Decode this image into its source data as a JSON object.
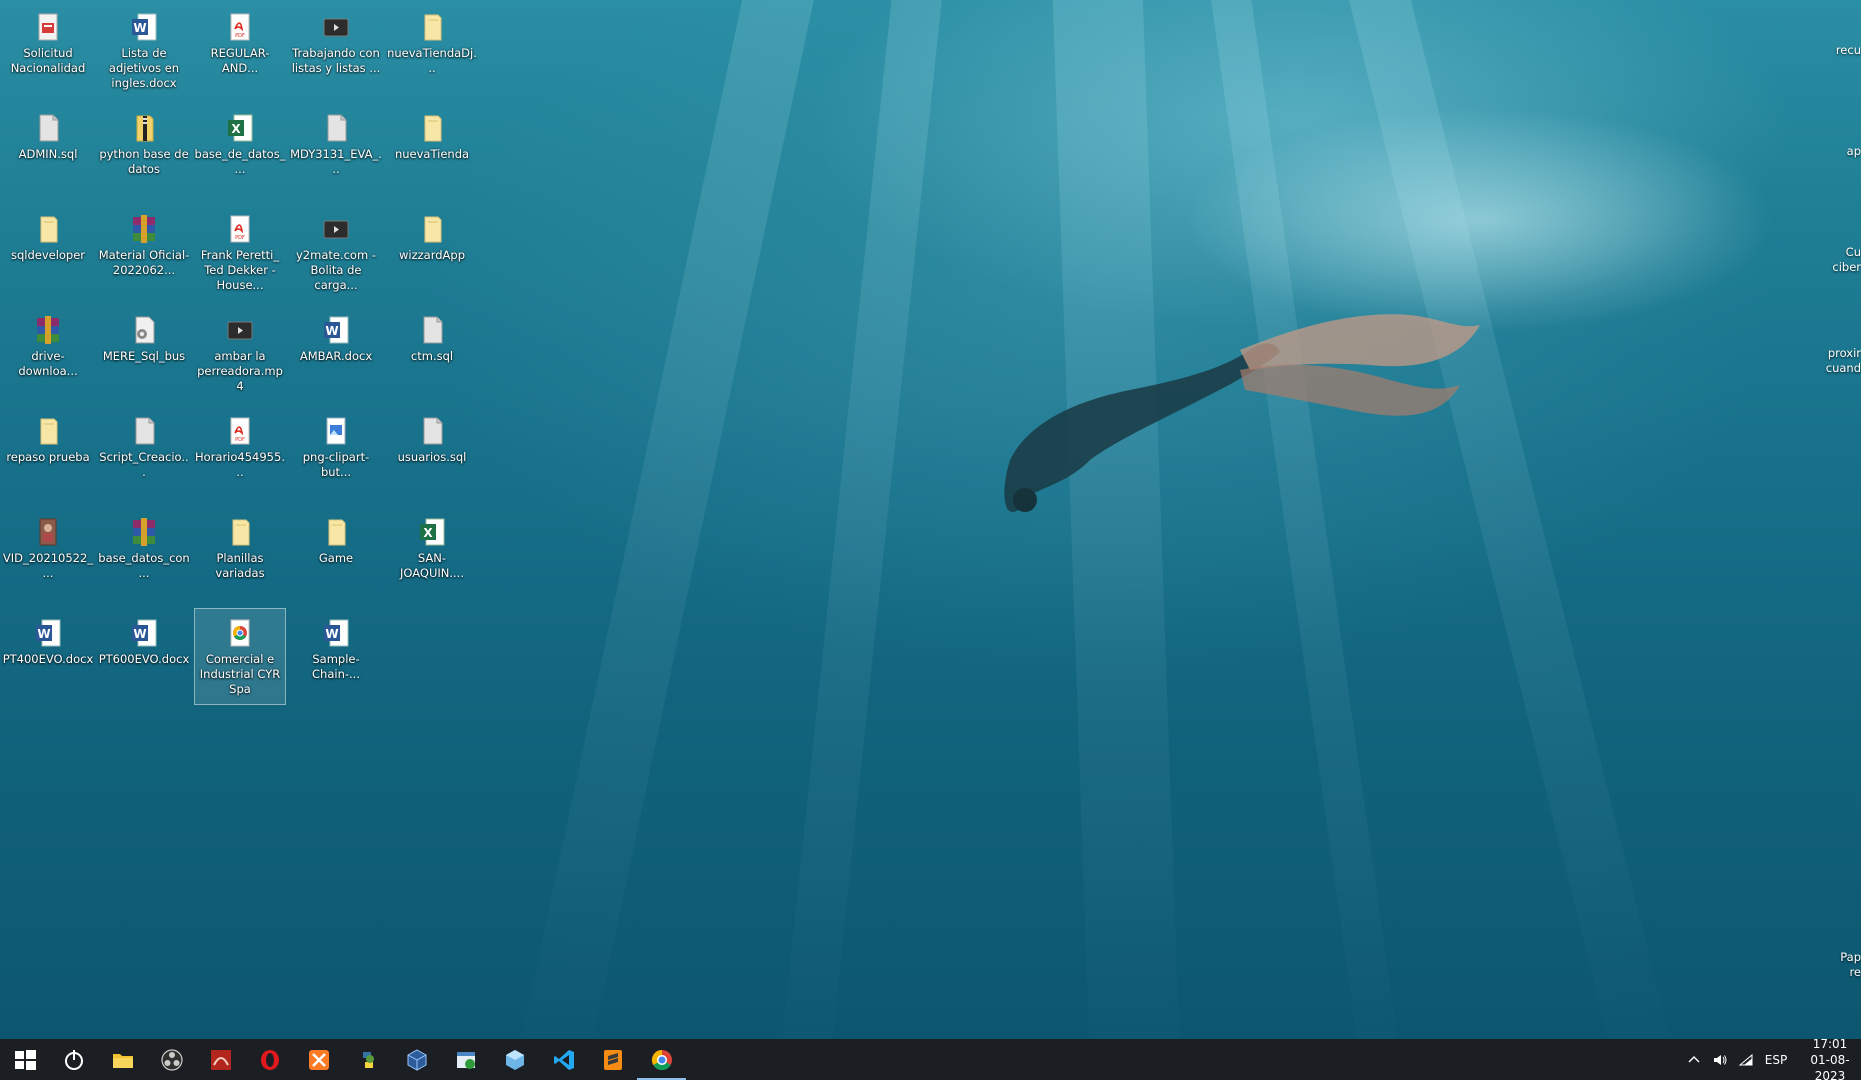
{
  "desktop": {
    "icons": [
      {
        "label": "Solicitud Nacionalidad",
        "icon": "document-icon"
      },
      {
        "label": "Lista de adjetivos en ingles.docx",
        "icon": "word-icon"
      },
      {
        "label": "REGULAR-AND...",
        "icon": "pdf-icon"
      },
      {
        "label": "Trabajando con listas y listas ...",
        "icon": "video-icon"
      },
      {
        "label": "nuevaTiendaDj...",
        "icon": "folder-icon"
      },
      {
        "label": "ADMIN.sql",
        "icon": "sql-file-icon"
      },
      {
        "label": "python base de datos",
        "icon": "folder-zip-icon"
      },
      {
        "label": "base_de_datos_...",
        "icon": "excel-icon"
      },
      {
        "label": "MDY3131_EVA_...",
        "icon": "sql-file-icon"
      },
      {
        "label": "nuevaTienda",
        "icon": "folder-icon"
      },
      {
        "label": "sqldeveloper",
        "icon": "folder-icon"
      },
      {
        "label": "Material Oficial-2022062...",
        "icon": "rar-icon"
      },
      {
        "label": "Frank Peretti_ Ted Dekker - House...",
        "icon": "pdf-icon"
      },
      {
        "label": "y2mate.com - Bolita de carga...",
        "icon": "video-icon"
      },
      {
        "label": "wizzardApp",
        "icon": "folder-icon"
      },
      {
        "label": "drive-downloa...",
        "icon": "rar-icon"
      },
      {
        "label": "MERE_Sql_bus",
        "icon": "settings-file-icon"
      },
      {
        "label": "ambar la perreadora.mp4",
        "icon": "video-icon"
      },
      {
        "label": "AMBAR.docx",
        "icon": "word-icon"
      },
      {
        "label": "ctm.sql",
        "icon": "sql-file-icon"
      },
      {
        "label": "repaso prueba",
        "icon": "folder-icon"
      },
      {
        "label": "Script_Creacio...",
        "icon": "sql-file-icon"
      },
      {
        "label": "Horario454955...",
        "icon": "pdf-icon"
      },
      {
        "label": "png-clipart-but...",
        "icon": "image-icon"
      },
      {
        "label": "usuarios.sql",
        "icon": "sql-file-icon"
      },
      {
        "label": "VID_20210522_...",
        "icon": "video-thumb-icon"
      },
      {
        "label": "base_datos_con...",
        "icon": "rar-icon"
      },
      {
        "label": "Planillas variadas",
        "icon": "folder-icon"
      },
      {
        "label": "Game",
        "icon": "folder-icon"
      },
      {
        "label": "SAN-JOAQUIN....",
        "icon": "excel-icon"
      },
      {
        "label": "PT400EVO.docx",
        "icon": "word-icon"
      },
      {
        "label": "PT600EVO.docx",
        "icon": "word-icon"
      },
      {
        "label": "Comercial e Industrial CYR Spa",
        "icon": "chrome-shortcut-icon",
        "selected": true
      },
      {
        "label": "Sample-Chain-...",
        "icon": "word-icon"
      }
    ],
    "right_edge_labels": [
      {
        "text": "recu"
      },
      {
        "text": "ap"
      },
      {
        "text": "Cu"
      },
      {
        "text": "ciber"
      },
      {
        "text": "proxir"
      },
      {
        "text": "cuand"
      },
      {
        "text": "Pap"
      },
      {
        "text": "re"
      }
    ]
  },
  "taskbar": {
    "apps": [
      {
        "name": "start-icon"
      },
      {
        "name": "power-icon"
      },
      {
        "name": "file-explorer-icon"
      },
      {
        "name": "obs-icon"
      },
      {
        "name": "mysql-workbench-icon"
      },
      {
        "name": "opera-icon"
      },
      {
        "name": "xampp-icon"
      },
      {
        "name": "python-idle-icon"
      },
      {
        "name": "virtualbox-icon"
      },
      {
        "name": "task-scheduler-icon"
      },
      {
        "name": "netbeans-icon"
      },
      {
        "name": "vscode-icon"
      },
      {
        "name": "sublime-text-icon"
      },
      {
        "name": "chrome-icon",
        "active": true
      }
    ],
    "tray": {
      "language": "ESP",
      "time": "17:01",
      "date": "01-08-2023"
    }
  },
  "colors": {
    "taskbar_bg": "#1b1f24",
    "water_top": "#2a8ea4",
    "water_bottom": "#0d5670",
    "active_indicator": "#8fbfe8"
  }
}
